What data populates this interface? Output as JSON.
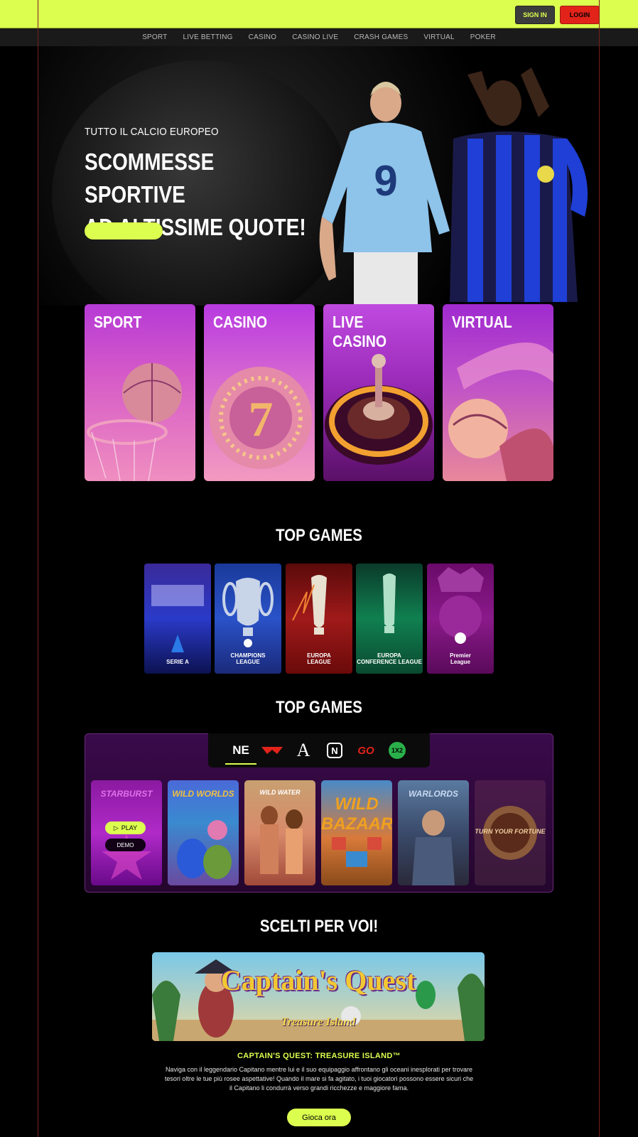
{
  "header": {
    "signin_label": "SIGN IN",
    "login_label": "LOGIN",
    "brand_color": "#dcff4f",
    "login_color": "#e2231a"
  },
  "nav": {
    "items": [
      "SPORT",
      "LIVE BETTING",
      "CASINO",
      "CASINO LIVE",
      "CRASH GAMES",
      "VIRTUAL",
      "POKER"
    ]
  },
  "hero": {
    "kicker": "TUTTO IL CALCIO EUROPEO",
    "title_line1": "SCOMMESSE SPORTIVE",
    "title_line2": "AD ALTISSIME QUOTE!",
    "cta_label": ""
  },
  "categories": [
    {
      "label": "SPORT"
    },
    {
      "label": "CASINO"
    },
    {
      "label": "LIVE CASINO"
    },
    {
      "label": "VIRTUAL"
    }
  ],
  "leagues_section": {
    "title": "TOP GAMES",
    "items": [
      {
        "name_line1": "SERIE A",
        "name_line2": "",
        "icon": "serie-a-logo"
      },
      {
        "name_line1": "CHAMPIONS",
        "name_line2": "LEAGUE",
        "icon": "champions-trophy"
      },
      {
        "name_line1": "EUROPA",
        "name_line2": "LEAGUE",
        "icon": "europa-trophy"
      },
      {
        "name_line1": "EUROPA",
        "name_line2": "CONFERENCE LEAGUE",
        "icon": "conference-trophy"
      },
      {
        "name_line1": "Premier",
        "name_line2": "League",
        "icon": "premier-lion"
      }
    ]
  },
  "games_section": {
    "title": "TOP GAMES",
    "providers": [
      {
        "label": "NE",
        "icon": "netent-logo",
        "active": true
      },
      {
        "label": "",
        "icon": "redtiger-logo",
        "active": false
      },
      {
        "label": "A",
        "icon": "aristocrat-logo",
        "active": false
      },
      {
        "label": "N",
        "icon": "novomatic-logo",
        "active": false
      },
      {
        "label": "GO",
        "icon": "go-logo",
        "active": false
      },
      {
        "label": "1X2",
        "icon": "1x2-logo",
        "active": false
      }
    ],
    "games": [
      {
        "title": "STARBURST"
      },
      {
        "title": "WILD WORLDS"
      },
      {
        "title": "WILD WATER"
      },
      {
        "title": "WILD BAZAAR"
      },
      {
        "title": "WARLORDS"
      },
      {
        "title": "TURN YOUR FORTUNE"
      }
    ],
    "play_label": "PLAY",
    "demo_label": "DEMO"
  },
  "featured": {
    "section_title": "SCELTI PER VOI!",
    "banner_title": "Captain's Quest",
    "banner_subtitle": "Treasure Island",
    "title": "CAPTAIN'S QUEST: TREASURE ISLAND™",
    "description": "Naviga con il leggendario Capitano mentre lui e il suo equipaggio affrontano gli oceani inesplorati per trovare tesori oltre le tue più rosee aspettative! Quando il mare si fa agitato, i tuoi giocatori possono essere sicuri che il Capitano li condurrà verso grandi ricchezze e maggiore fama.",
    "cta_label": "Gioca ora"
  }
}
